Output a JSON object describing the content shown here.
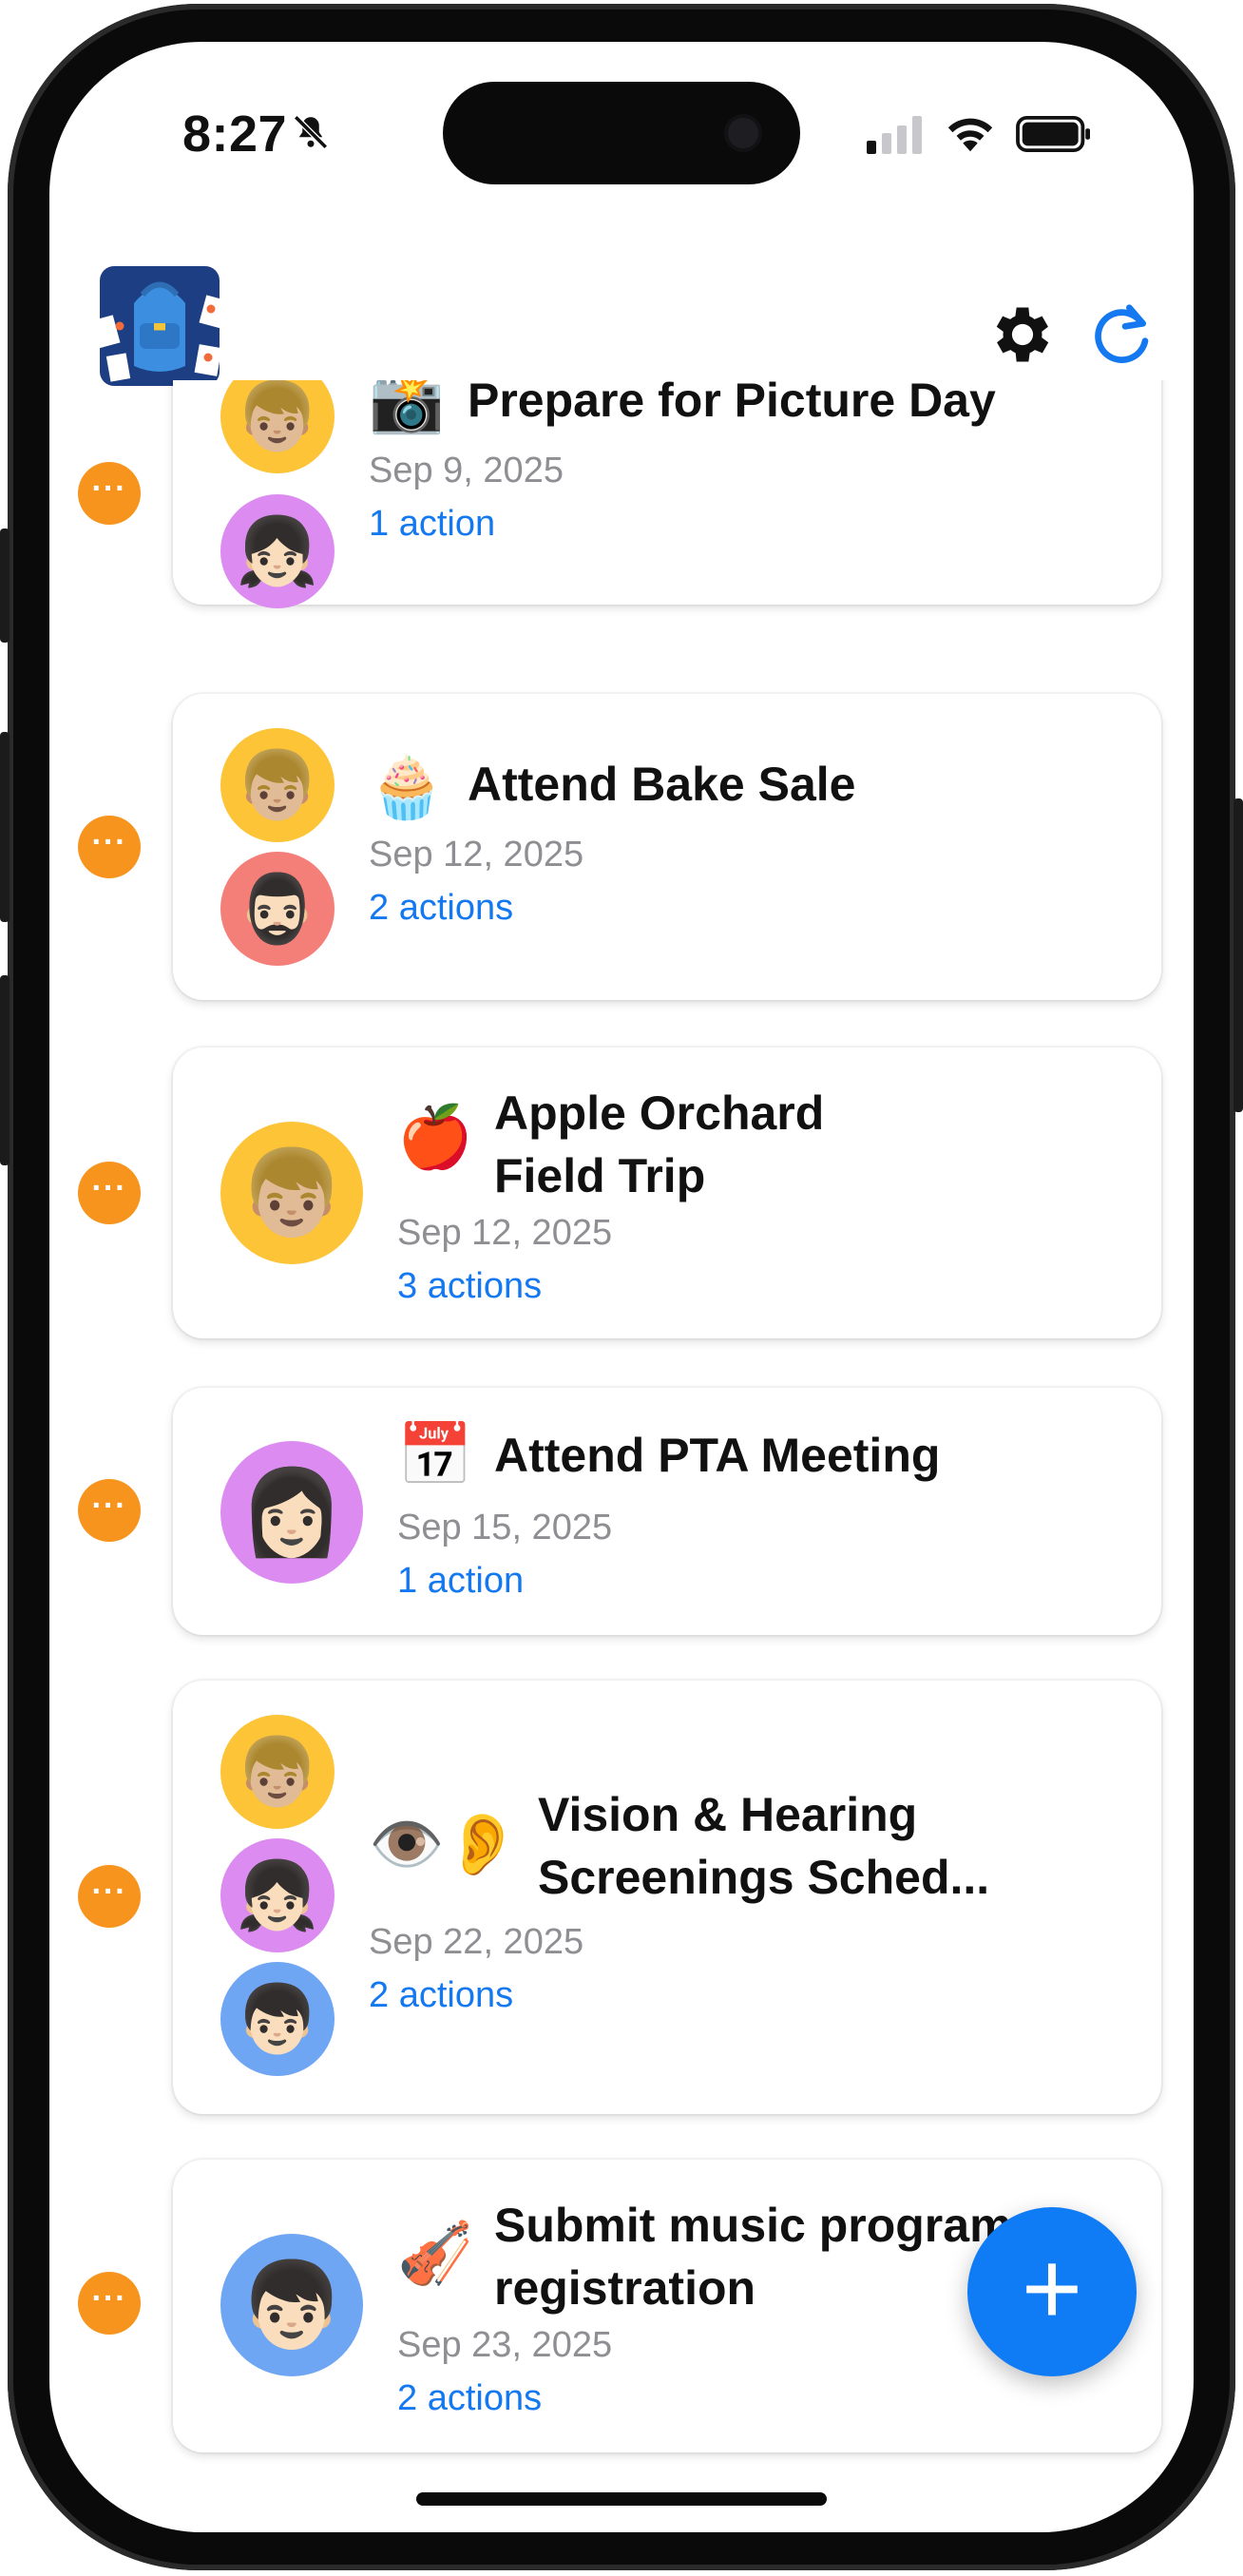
{
  "status_bar": {
    "time": "8:27"
  },
  "header": {
    "logo": "backpack-logo",
    "settings_icon": "gear-icon",
    "refresh_icon": "refresh-icon"
  },
  "events": [
    {
      "title": "Prepare for Picture Day",
      "emoji": "📸",
      "date": "Sep 9, 2025",
      "actions": "1 action",
      "avatars": [
        "👦🏼",
        "👧🏻"
      ]
    },
    {
      "title": "Attend Bake Sale",
      "emoji": "🧁",
      "date": "Sep 12, 2025",
      "actions": "2 actions",
      "avatars": [
        "👦🏼",
        "🧔🏻‍♂️"
      ]
    },
    {
      "title": "Apple Orchard\nField Trip",
      "emoji": "🍎",
      "date": "Sep 12, 2025",
      "actions": "3 actions",
      "avatars": [
        "👦🏼"
      ]
    },
    {
      "title": "Attend PTA Meeting",
      "emoji": "📅",
      "date": "Sep 15, 2025",
      "actions": "1 action",
      "avatars": [
        "👩🏻"
      ]
    },
    {
      "title": "Vision & Hearing\nScreenings Sched...",
      "emoji": "👁️👂",
      "date": "Sep 22, 2025",
      "actions": "2 actions",
      "avatars": [
        "👦🏼",
        "👧🏻",
        "👦🏻"
      ]
    },
    {
      "title": "Submit music program\nregistration",
      "emoji": "🎻",
      "date": "Sep 23, 2025",
      "actions": "2 actions",
      "avatars": [
        "👦🏻"
      ]
    }
  ],
  "more_label": "···",
  "fab_label": "+"
}
